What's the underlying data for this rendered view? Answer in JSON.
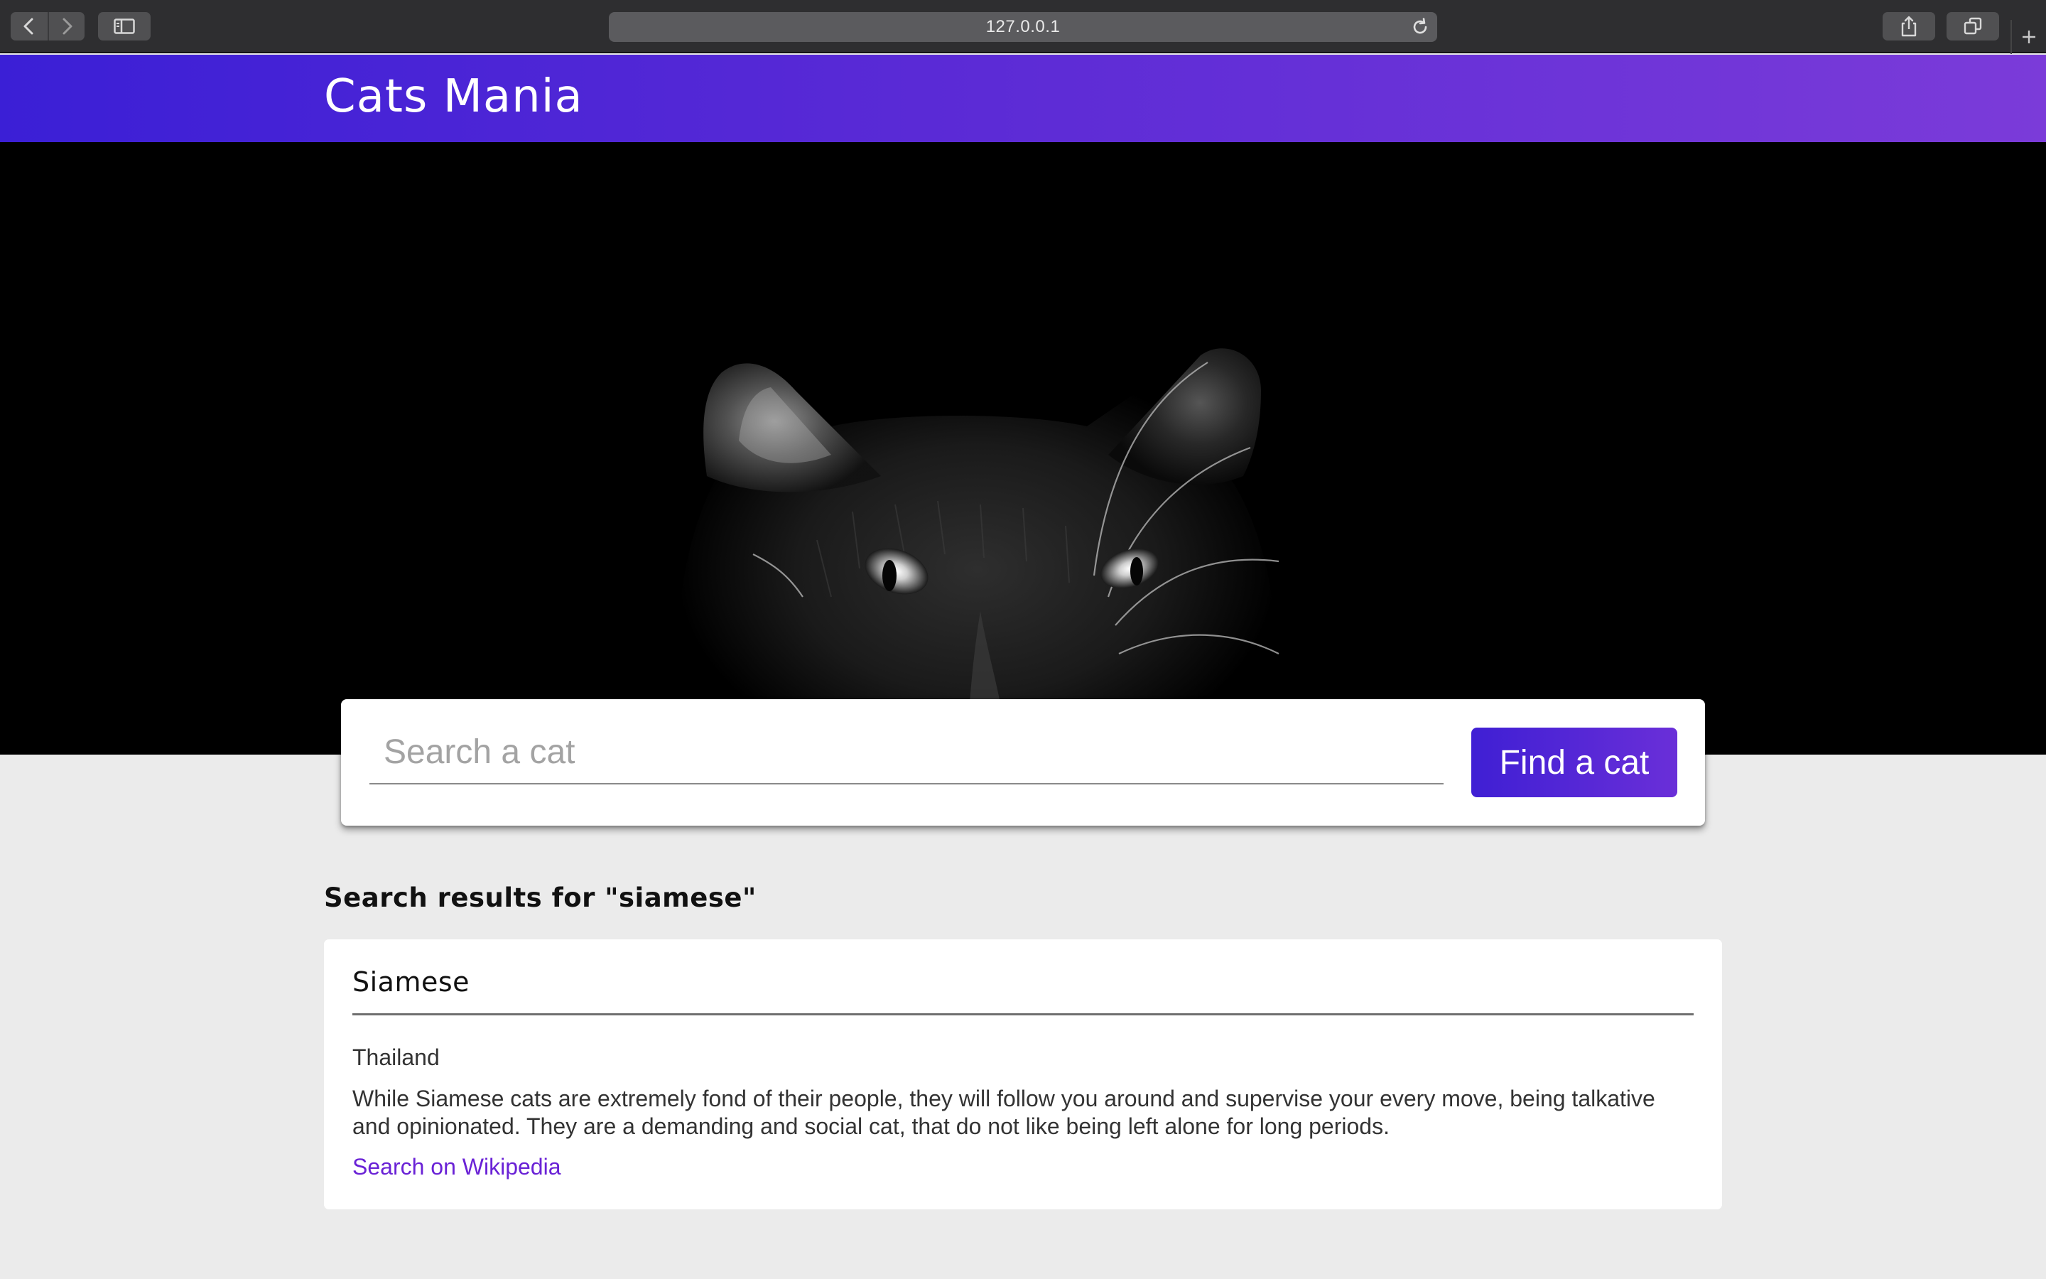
{
  "browser": {
    "url": "127.0.0.1",
    "icons": {
      "back": "chevron-left-icon",
      "forward": "chevron-right-icon",
      "sidebar": "sidebar-icon",
      "reload": "reload-icon",
      "share": "share-icon",
      "tabs": "tabs-overview-icon",
      "new_tab": "plus-icon"
    }
  },
  "header": {
    "title": "Cats Mania"
  },
  "hero": {
    "image": "black-cat-photo"
  },
  "search": {
    "placeholder": "Search a cat",
    "value": "",
    "button_label": "Find a cat"
  },
  "results": {
    "heading": "Search results for \"siamese\"",
    "items": [
      {
        "name": "Siamese",
        "origin": "Thailand",
        "description": "While Siamese cats are extremely fond of their people, they will follow you around and supervise your every move, being talkative and opinionated. They are a demanding and social cat, that do not like being left alone for long periods.",
        "link_label": "Search on Wikipedia"
      }
    ]
  },
  "colors": {
    "accent_start": "#3b1fd6",
    "accent_end": "#7b3bd9",
    "link": "#6a22d6",
    "page_background": "#ebebeb"
  }
}
